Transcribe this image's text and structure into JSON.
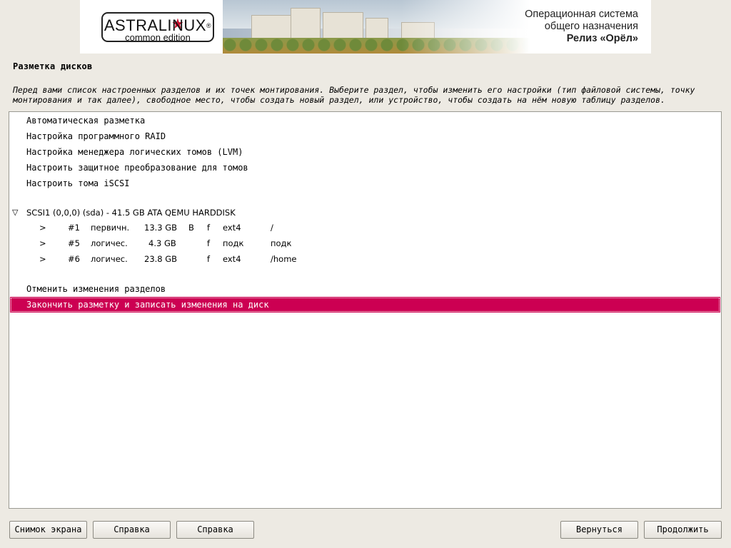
{
  "banner": {
    "logo_main": "ASTRALINUX",
    "logo_reg": "®",
    "logo_sub": "common edition",
    "line1": "Операционная система",
    "line2": "общего назначения",
    "line3": "Релиз «Орёл»",
    "accent_color": "#c8102e"
  },
  "page": {
    "title": "Разметка дисков",
    "description": "Перед вами список настроенных разделов и их точек монтирования. Выберите раздел, чтобы изменить его настройки (тип файловой системы, точку монтирования и так далее), свободное место, чтобы создать новый раздел, или устройство, чтобы создать на нём новую таблицу разделов."
  },
  "menu": {
    "auto": "Автоматическая разметка",
    "raid": "Настройка программного RAID",
    "lvm": "Настройка менеджера логических томов (LVM)",
    "crypto": "Настроить защитное преобразование для томов",
    "iscsi": "Настроить тома iSCSI",
    "undo": "Отменить изменения разделов",
    "finish": "Закончить разметку и записать изменения на диск"
  },
  "disk": {
    "expand_icon": "triangle-down-icon",
    "label": "SCSI1 (0,0,0) (sda) - 41.5 GB ATA QEMU HARDDISK"
  },
  "partitions": [
    {
      "arrow": ">",
      "num": "#1",
      "type": "первичн.",
      "size": "13.3 GB",
      "boot": "B",
      "fmt": "f",
      "fs": "ext4",
      "mount": "/"
    },
    {
      "arrow": ">",
      "num": "#5",
      "type": "логичес.",
      "size": "4.3 GB",
      "boot": "",
      "fmt": "f",
      "fs": "подк",
      "mount": "подк"
    },
    {
      "arrow": ">",
      "num": "#6",
      "type": "логичес.",
      "size": "23.8 GB",
      "boot": "",
      "fmt": "f",
      "fs": "ext4",
      "mount": "/home"
    }
  ],
  "buttons": {
    "screenshot": "Снимок экрана",
    "help1": "Справка",
    "help2": "Справка",
    "back": "Вернуться",
    "continue": "Продолжить"
  },
  "colors": {
    "selection": "#cc0052",
    "background": "#edeae3"
  }
}
